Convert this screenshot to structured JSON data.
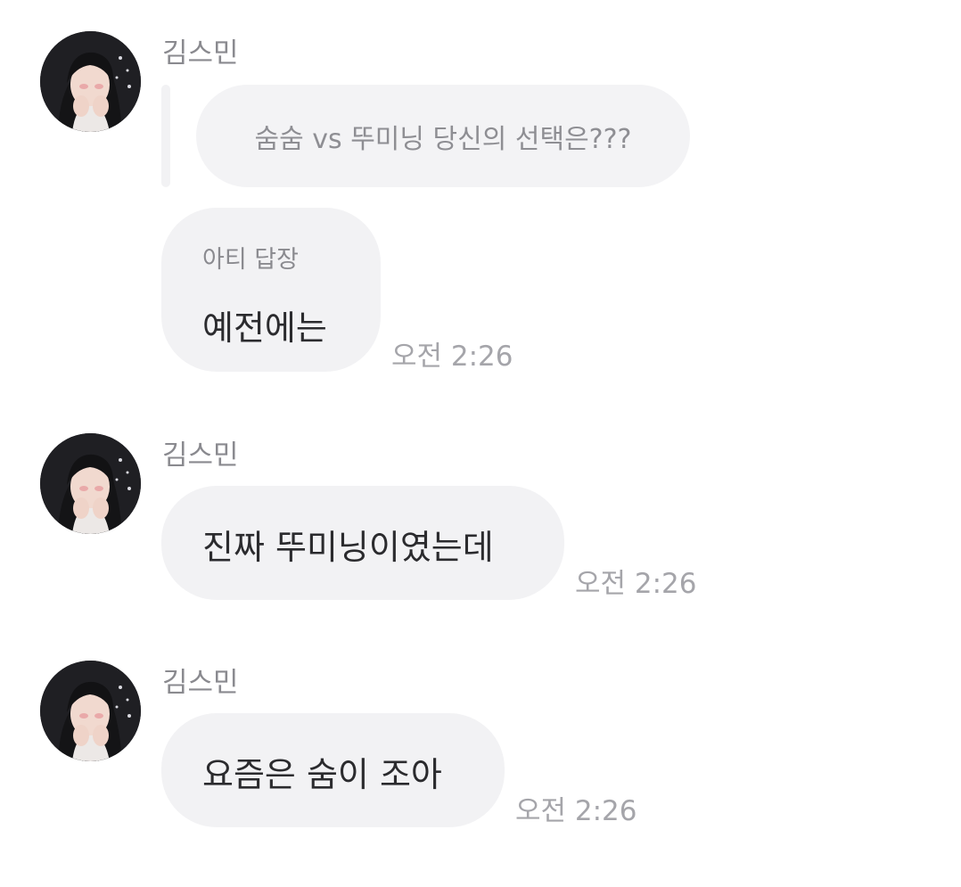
{
  "messages": [
    {
      "sender": "김스민",
      "quoted_text": "숨숨 vs 뚜미닝 당신의 선택은???",
      "reply_label": "아티 답장",
      "text": "예전에는",
      "time": "오전 2:26"
    },
    {
      "sender": "김스민",
      "text": "진짜 뚜미닝이였는데",
      "time": "오전 2:26"
    },
    {
      "sender": "김스민",
      "text": "요즘은 숨이 조아",
      "time": "오전 2:26"
    }
  ],
  "colors": {
    "bubble_bg": "#f2f2f4",
    "name_text": "#8a8a8f",
    "message_text": "#2b2b2e",
    "time_text": "#a5a5aa"
  }
}
